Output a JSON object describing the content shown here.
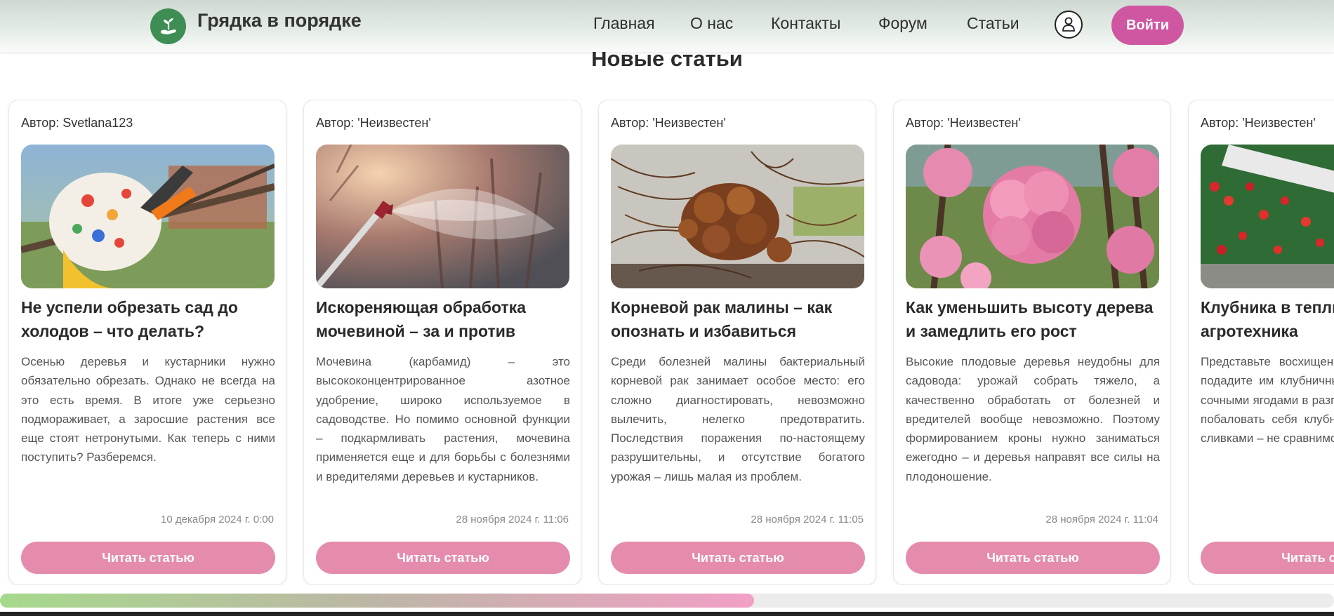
{
  "header": {
    "brand": "Грядка в порядке",
    "nav": [
      "Главная",
      "О нас",
      "Контакты",
      "Форум",
      "Статьи"
    ],
    "user_icon": "user-icon",
    "login_label": "Войти",
    "accent_color": "#cf56a1",
    "logo_color": "#3e8d55"
  },
  "section_title": "Новые статьи",
  "cards": [
    {
      "author": "Автор: Svetlana123",
      "title": "Не успели обрезать сад до холодов – что делать?",
      "excerpt": "Осенью деревья и кустарники нужно обязательно обрезать. Однако не всегда на это есть время. В итоге уже серьезно подмораживает, а заросшие растения все еще стоят нетронутыми. Как теперь с ними поступить? Разберемся.",
      "date": "10 декабря 2024 г. 0:00",
      "button": "Читать статью",
      "image": "pruning-shears-gloves"
    },
    {
      "author": "Автор: 'Неизвестен'",
      "title": "Искореняющая обработка мочевиной – за и против",
      "excerpt": "Мочевина (карбамид) – это высококонцентрированное азотное удобрение, широко используемое в садоводстве. Но помимо основной функции – подкармливать растения, мочевина применяется еще и для борьбы с болезнями и вредителями деревьев и кустарников.",
      "date": "28 ноября 2024 г. 11:06",
      "button": "Читать статью",
      "image": "sprayer-mist"
    },
    {
      "author": "Автор: 'Неизвестен'",
      "title": "Корневой рак малины – как опознать и избавиться",
      "excerpt": "Среди болезней малины бактериальный корневой рак занимает особое место: его сложно диагностировать, невозможно вылечить, нелегко предотвратить. Последствия поражения по-настоящему разрушительны, и отсутствие богатого урожая – лишь малая из проблем.",
      "date": "28 ноября 2024 г. 11:05",
      "button": "Читать статью",
      "image": "root-gall"
    },
    {
      "author": "Автор: 'Неизвестен'",
      "title": "Как уменьшить высоту дерева и замедлить его рост",
      "excerpt": "Высокие плодовые деревья неудобны для садовода: урожай собрать тяжело, а качественно обработать от болезней и вредителей вообще невозможно. Поэтому формированием кроны нужно заниматься ежегодно – и деревья направят все силы на плодоношение.",
      "date": "28 ноября 2024 г. 11:04",
      "button": "Читать статью",
      "image": "pink-blossom"
    },
    {
      "author": "Автор: 'Неизвестен'",
      "title": "Клубника в теплице: агротехника",
      "excerpt": "Представьте восхищение гостей, когда вы подадите им клубничный смузи или торт с сочными ягодами в разгар зимы. Как приятно побаловать себя клубникой с сахаром или сливками – не сравнимое удовольствие.",
      "date": "",
      "button": "Читать статью",
      "image": "strawberry-greenhouse"
    }
  ],
  "scrollbar": {
    "position_fraction": 0.565
  }
}
